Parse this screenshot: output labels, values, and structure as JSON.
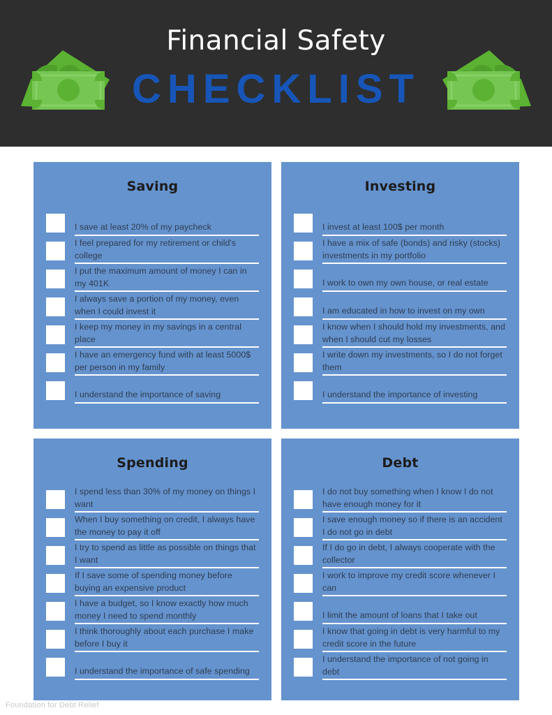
{
  "header": {
    "title": "Financial Safety",
    "subtitle": "CHECKLIST",
    "background_color": "#2e2e2e",
    "title_color": "#ffffff",
    "subtitle_color": "#1756b8",
    "left_illustration": "money-bills-icon",
    "right_illustration": "money-bills-icon"
  },
  "colors": {
    "card": "#6593ce",
    "checkbox": "#ffffff",
    "rule": "#ffffff",
    "item_text": "#2f3d50",
    "card_title": "#1c1c1c",
    "money_front": "#6cc04a",
    "money_back": "#5cb233",
    "page_background": "#ffffff"
  },
  "cards": [
    {
      "title": "Saving",
      "items": [
        "I save at least 20% of my paycheck",
        "I feel prepared for my retirement or child's college",
        "I put the maximum amount of money I can in my 401K",
        "I always save a portion of my money, even when I could invest it",
        "I keep my money in my savings in a central place",
        "I have an emergency fund with at least 5000$ per person in my family",
        "I understand the importance of saving"
      ]
    },
    {
      "title": "Investing",
      "items": [
        "I invest at least 100$ per month",
        "I have a mix of safe (bonds) and risky (stocks) investments in my portfolio",
        "I work to own my own house, or real estate",
        "I am educated in how to invest on my own",
        "I know when I should hold my investments, and when I should cut my losses",
        "I write down my investments, so I do not forget them",
        "I understand the importance of investing"
      ]
    },
    {
      "title": "Spending",
      "items": [
        "I spend less than 30% of my money on things I want",
        "When I buy something on credit, I always have the money to pay it off",
        "I try to spend as little as possible on things that I want",
        "If I save some of spending money before buying an expensive product",
        "I have a budget, so I know exactly how much money I need to spend monthly",
        "I think thoroughly about each purchase I make before I buy it",
        "I understand the importance of safe spending"
      ]
    },
    {
      "title": "Debt",
      "items": [
        "I do not buy something when I know I do not have enough money for it",
        "I save enough money so if there is an accident I do not go in debt",
        "If I do go in debt, I always cooperate with the collector",
        "I work to improve my credit score whenever I can",
        "I limit the amount of loans that I take out",
        "I know that going in debt is very harmful to my credit score in the future",
        "I understand the importance of not going in debt"
      ]
    }
  ],
  "footer": {
    "text": "Foundation for Debt Relief"
  }
}
